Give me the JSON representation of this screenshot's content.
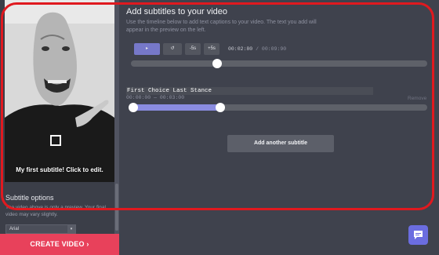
{
  "preview": {
    "caption": "My first subtitle! Click to edit."
  },
  "options": {
    "title": "Subtitle options",
    "note": "The video above is only a preview. Your final video may vary slightly.",
    "font": "Arial"
  },
  "create_button": {
    "label": "CREATE VIDEO  ›"
  },
  "editor": {
    "title": "Add subtitles to your video",
    "description": "Use the timeline below to add text captions to your video. The text you add will appear in the preview on the left."
  },
  "player": {
    "play_label": "▸",
    "restart_label": "↺",
    "back_label": "-5s",
    "forward_label": "+5s",
    "current_time": "00:02:80",
    "separator": " / ",
    "total_time": "00:09:90",
    "position_fraction": 0.29
  },
  "subtitle": {
    "text": "First Choice Last Stance",
    "range": "00:00:00 — 00:03:00",
    "remove_label": "Remove",
    "start_fraction": 0.0,
    "end_fraction": 0.3
  },
  "add_button": {
    "label": "Add another subtitle"
  },
  "colors": {
    "accent": "#7678c9",
    "cta": "#e8415b",
    "highlight": "#e0191f",
    "panel": "#3f424d"
  },
  "icons": {
    "chat": "chat-bubble-icon",
    "play": "play-icon",
    "restart": "restart-icon"
  }
}
